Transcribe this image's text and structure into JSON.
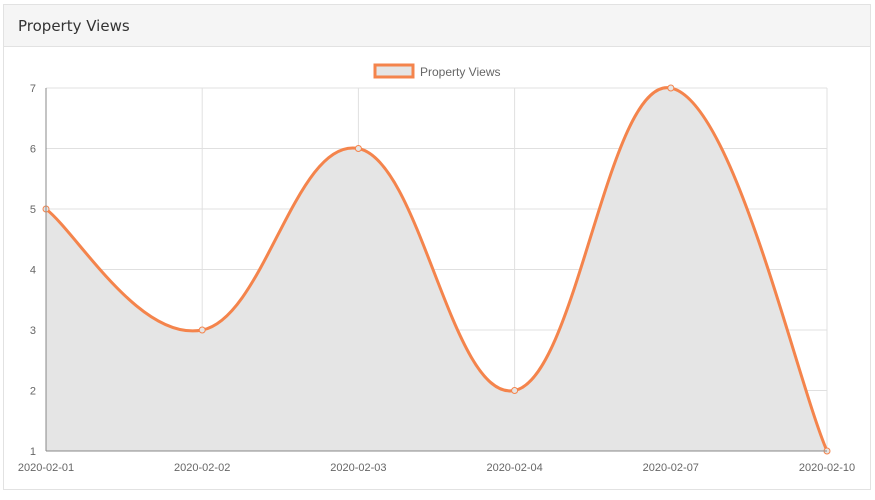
{
  "panel": {
    "title": "Property Views"
  },
  "chart_data": {
    "type": "area",
    "categories": [
      "2020-02-01",
      "2020-02-02",
      "2020-02-03",
      "2020-02-04",
      "2020-02-07",
      "2020-02-10"
    ],
    "series": [
      {
        "name": "Property Views",
        "values": [
          5,
          3,
          6,
          2,
          7,
          1
        ]
      }
    ],
    "ylim": [
      1,
      7
    ],
    "yticks": [
      1,
      2,
      3,
      4,
      5,
      6,
      7
    ],
    "grid": true,
    "legend": "top-center",
    "colors": {
      "line": "#f4844c",
      "fill": "#e5e5e5",
      "grid": "#e0e0e0",
      "axis": "#888888",
      "tick_text": "#666666"
    }
  }
}
